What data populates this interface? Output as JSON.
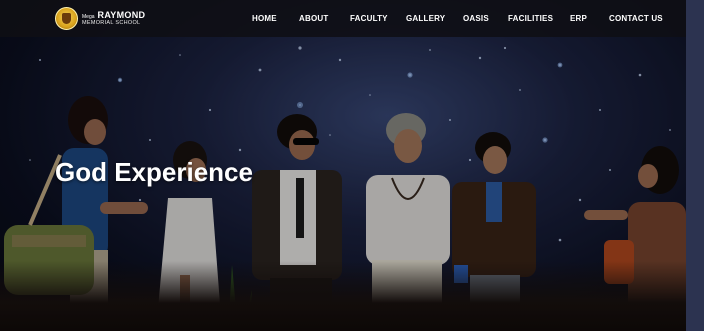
{
  "logo": {
    "prefix": "Mega",
    "name": "RAYMOND",
    "subtitle": "MEMORIAL SCHOOL"
  },
  "nav": {
    "items": [
      {
        "label": "HOME"
      },
      {
        "label": "ABOUT"
      },
      {
        "label": "FACULTY"
      },
      {
        "label": "GALLERY"
      },
      {
        "label": "OASIS"
      },
      {
        "label": "FACILITIES"
      },
      {
        "label": "ERP"
      },
      {
        "label": "CONTACT US"
      }
    ]
  },
  "hero": {
    "title": "God Experience"
  }
}
